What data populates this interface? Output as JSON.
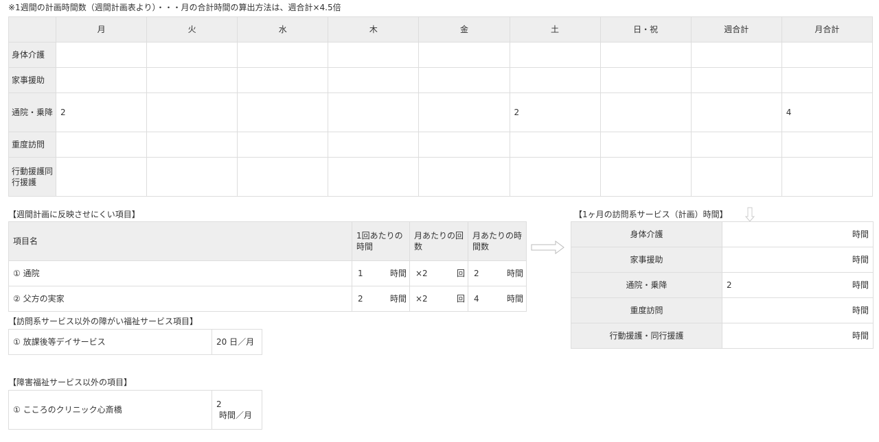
{
  "note": "※1週間の計画時間数（週間計画表より）・・・月の合計時間の算出方法は、週合計×4.5倍",
  "weekly": {
    "headers": [
      "",
      "月",
      "火",
      "水",
      "木",
      "金",
      "土",
      "日・祝",
      "週合計",
      "月合計"
    ],
    "rows": [
      {
        "label": "身体介護",
        "cells": [
          "",
          "",
          "",
          "",
          "",
          "",
          "",
          "",
          ""
        ]
      },
      {
        "label": "家事援助",
        "cells": [
          "",
          "",
          "",
          "",
          "",
          "",
          "",
          "",
          ""
        ]
      },
      {
        "label": "通院・乗降",
        "cells": [
          "2",
          "",
          "",
          "",
          "",
          "2",
          "",
          "",
          "4"
        ]
      },
      {
        "label": "重度訪問",
        "cells": [
          "",
          "",
          "",
          "",
          "",
          "",
          "",
          "",
          ""
        ]
      },
      {
        "label": "行動援護同行援護",
        "cells": [
          "",
          "",
          "",
          "",
          "",
          "",
          "",
          "",
          ""
        ]
      }
    ]
  },
  "items_section": {
    "title": "【週間計画に反映させにくい項目】",
    "headers": [
      "項目名",
      "1回あたりの時間",
      "月あたりの回数",
      "月あたりの時間数"
    ],
    "rows": [
      {
        "name": "① 通院",
        "per": "1",
        "per_unit": "時間",
        "count": "×2",
        "count_unit": "回",
        "total": "2",
        "total_unit": "時間"
      },
      {
        "name": "② 父方の実家",
        "per": "2",
        "per_unit": "時間",
        "count": "×2",
        "count_unit": "回",
        "total": "4",
        "total_unit": "時間"
      }
    ]
  },
  "welfare_section": {
    "title": "【訪問系サービス以外の障がい福祉サービス項目】",
    "rows": [
      {
        "name": "① 放課後等デイサービス",
        "value": "20 日／月"
      }
    ]
  },
  "other_section": {
    "title": "【障害福祉サービス以外の項目】",
    "rows": [
      {
        "name": "① こころのクリニック心斎橋",
        "value": "2",
        "unit": "時間／月"
      }
    ]
  },
  "monthly_section": {
    "title": "【1ヶ月の訪問系サービス（計画）時間】",
    "rows": [
      {
        "label": "身体介護",
        "value": "",
        "unit": "時間"
      },
      {
        "label": "家事援助",
        "value": "",
        "unit": "時間"
      },
      {
        "label": "通院・乗降",
        "value": "2",
        "unit": "時間"
      },
      {
        "label": "重度訪問",
        "value": "",
        "unit": "時間"
      },
      {
        "label": "行動援護・同行援護",
        "value": "",
        "unit": "時間"
      }
    ]
  },
  "icons": {
    "arrow_right": "arrow-right-icon",
    "arrow_down": "arrow-down-icon"
  }
}
